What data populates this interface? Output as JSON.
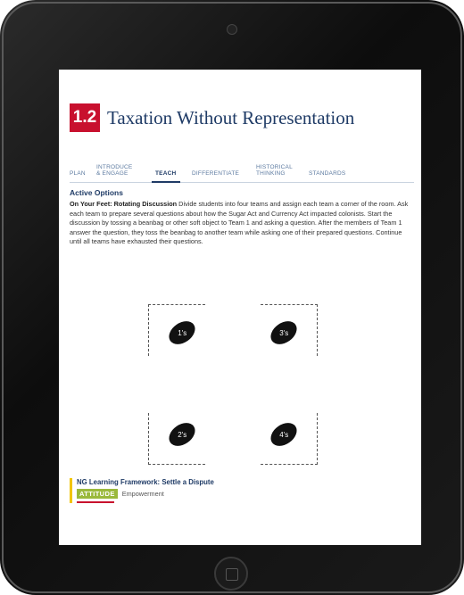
{
  "lesson": {
    "number": "1.2",
    "title": "Taxation Without Representation"
  },
  "tabs": [
    {
      "label": "PLAN",
      "active": false
    },
    {
      "label": "INTRODUCE\n& ENGAGE",
      "active": false
    },
    {
      "label": "TEACH",
      "active": true
    },
    {
      "label": "DIFFERENTIATE",
      "active": false
    },
    {
      "label": "HISTORICAL\nTHINKING",
      "active": false
    },
    {
      "label": "STANDARDS",
      "active": false
    }
  ],
  "content": {
    "heading": "Active Options",
    "lead": "On Your Feet: Rotating Discussion",
    "body": "Divide students into four teams and assign each team a corner of the room. Ask each team to prepare several questions about how the Sugar Act and Currency Act impacted colonists. Start the discussion by tossing a beanbag or other soft object to Team 1 and asking a question. After the members of Team 1 answer the question, they toss the beanbag to another team while asking one of their prepared questions. Continue until all teams have exhausted their questions."
  },
  "diagram": {
    "teams": [
      "1's",
      "3's",
      "2's",
      "4's"
    ]
  },
  "framework": {
    "title": "NG Learning Framework: Settle a Dispute",
    "tag": "ATTITUDE",
    "value": "Empowerment"
  },
  "colors": {
    "badge_red": "#c8102e",
    "title_blue": "#1f3b66",
    "attitude_green": "#9ab93b",
    "framework_bar_yellow": "#f2c500"
  }
}
